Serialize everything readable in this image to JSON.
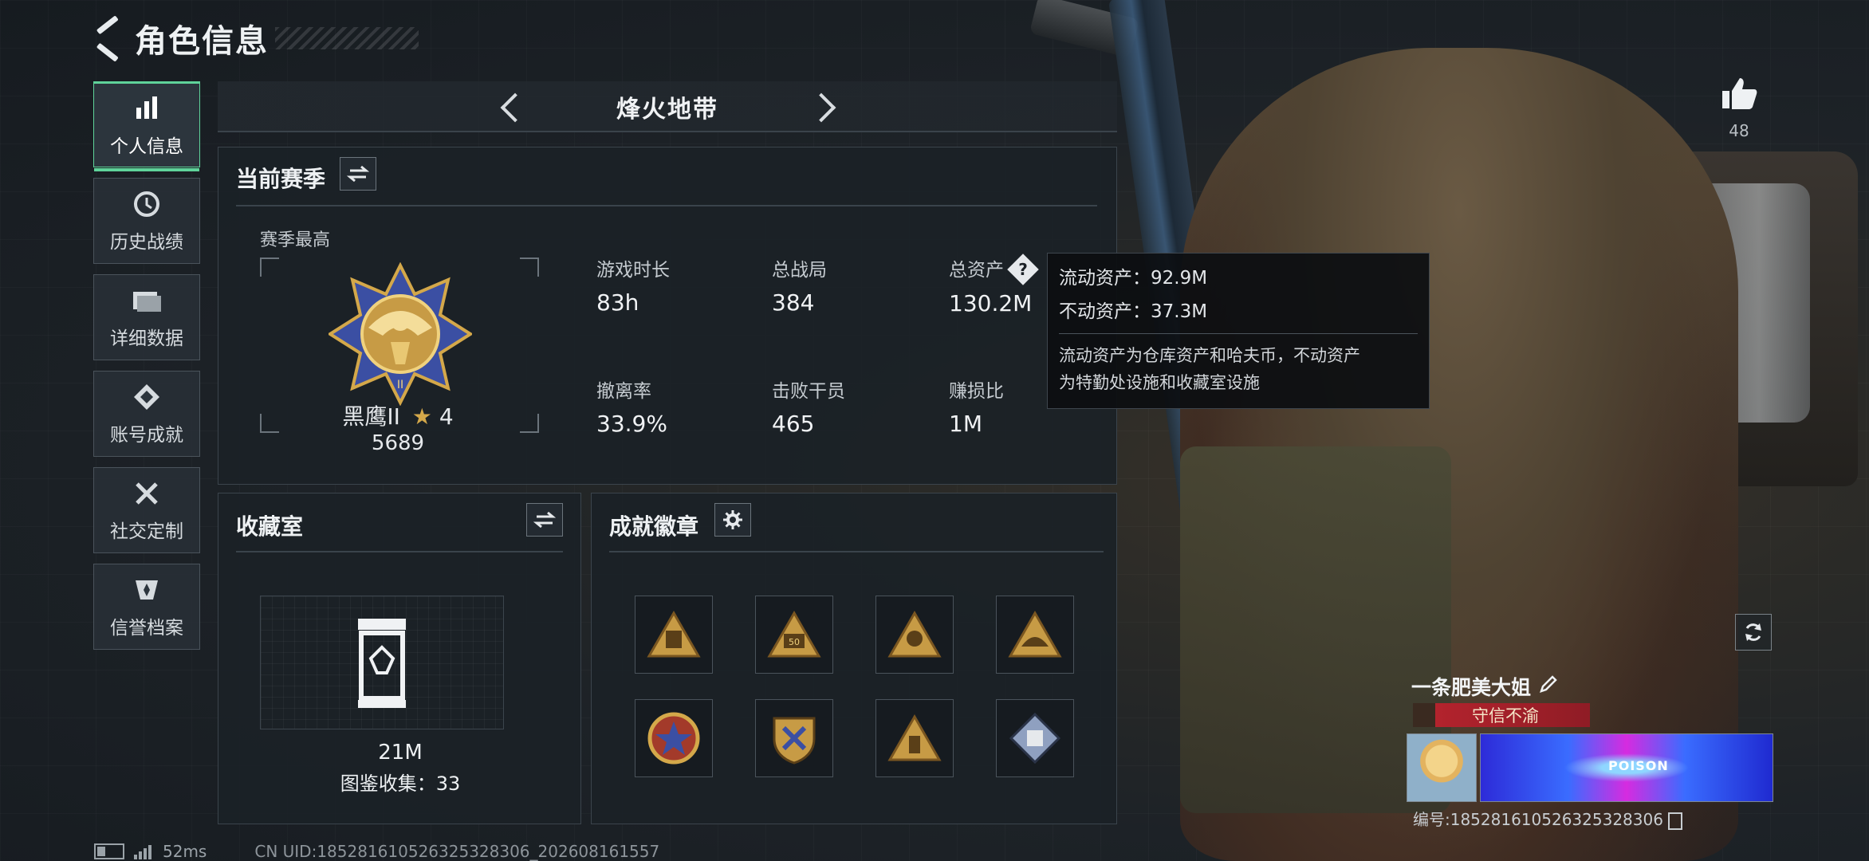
{
  "header": {
    "title": "角色信息"
  },
  "sidebar": {
    "items": [
      {
        "label": "个人信息",
        "icon": "bar-chart-icon",
        "active": true
      },
      {
        "label": "历史战绩",
        "icon": "history-icon"
      },
      {
        "label": "详细数据",
        "icon": "folder-icon"
      },
      {
        "label": "账号成就",
        "icon": "achievement-icon"
      },
      {
        "label": "社交定制",
        "icon": "tools-icon"
      },
      {
        "label": "信誉档案",
        "icon": "credit-icon"
      }
    ]
  },
  "map": {
    "name": "烽火地带"
  },
  "season": {
    "title": "当前赛季",
    "subtitle": "赛季最高",
    "rank_name": "黑鹰II",
    "rank_stars": "4",
    "rank_score": "5689",
    "stats": [
      {
        "label": "游戏时长",
        "value": "83h"
      },
      {
        "label": "总战局",
        "value": "384"
      },
      {
        "label": "总资产",
        "value": "130.2M",
        "help": true
      },
      {
        "label": "撤离率",
        "value": "33.9%"
      },
      {
        "label": "击败干员",
        "value": "465"
      },
      {
        "label": "赚损比",
        "value": "1M"
      }
    ]
  },
  "tooltip": {
    "line1": "流动资产：92.9M",
    "line2": "不动资产：37.3M",
    "desc1": "流动资产为仓库资产和哈夫币，不动资产",
    "desc2": "为特勤处设施和收藏室设施"
  },
  "collection": {
    "title": "收藏室",
    "value": "21M",
    "count_text": "图鉴收集：33"
  },
  "badges": {
    "title": "成就徽章",
    "items": [
      "badge-1",
      "badge-2",
      "badge-3",
      "badge-4",
      "badge-5",
      "badge-6",
      "badge-7",
      "badge-8"
    ]
  },
  "profile": {
    "likes": "48",
    "name": "一条肥美大姐",
    "title_tag": "守信不渝",
    "banner_text": "POISON",
    "uid": "编号:1852816105263253283​06"
  },
  "status": {
    "ping": "52ms",
    "uid": "CN UID:1852816105263253283​06_202608161557"
  },
  "colors": {
    "accent": "#5fd39a",
    "gold": "#d4a84a",
    "tag_red": "#b3232d"
  }
}
